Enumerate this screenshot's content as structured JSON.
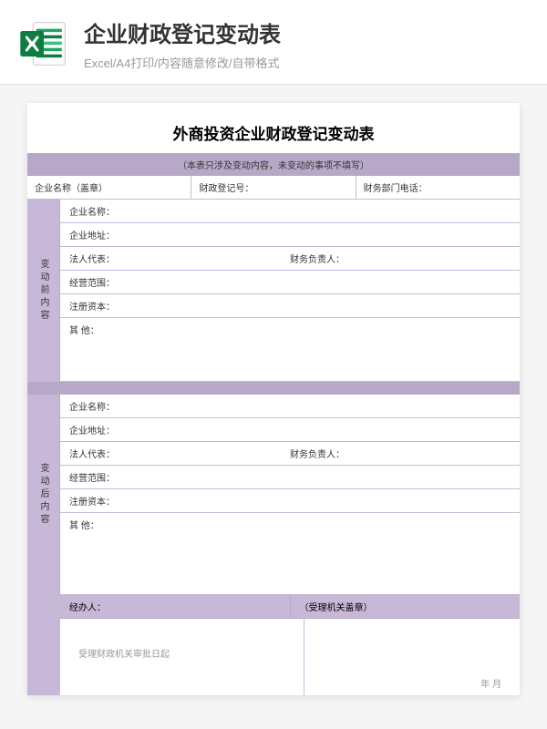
{
  "header": {
    "title": "企业财政登记变动表",
    "subtitle": "Excel/A4打印/内容随意修改/自带格式"
  },
  "sheet": {
    "title": "外商投资企业财政登记变动表",
    "note": "（本表只涉及变动内容，未变动的事项不填写）",
    "info": {
      "company_name": "企业名称（盖章）",
      "reg_no": "财政登记号：",
      "phone": "财务部门电话："
    },
    "before": {
      "label": "变动前内容",
      "fields": {
        "name": "企业名称：",
        "address": "企业地址：",
        "legal_rep": "法人代表：",
        "finance_head": "财务负责人：",
        "scope": "经营范围：",
        "capital": "注册资本：",
        "other": "其 他："
      }
    },
    "after": {
      "label": "变动后内容",
      "fields": {
        "name": "企业名称：",
        "address": "企业地址：",
        "legal_rep": "法人代表：",
        "finance_head": "财务负责人：",
        "scope": "经营范围：",
        "capital": "注册资本：",
        "other": "其 他："
      }
    },
    "footer": {
      "handler": "经办人：",
      "stamp": "（受理机关盖章）",
      "approval": "受理财政机关审批日起",
      "date": "年        月"
    }
  }
}
